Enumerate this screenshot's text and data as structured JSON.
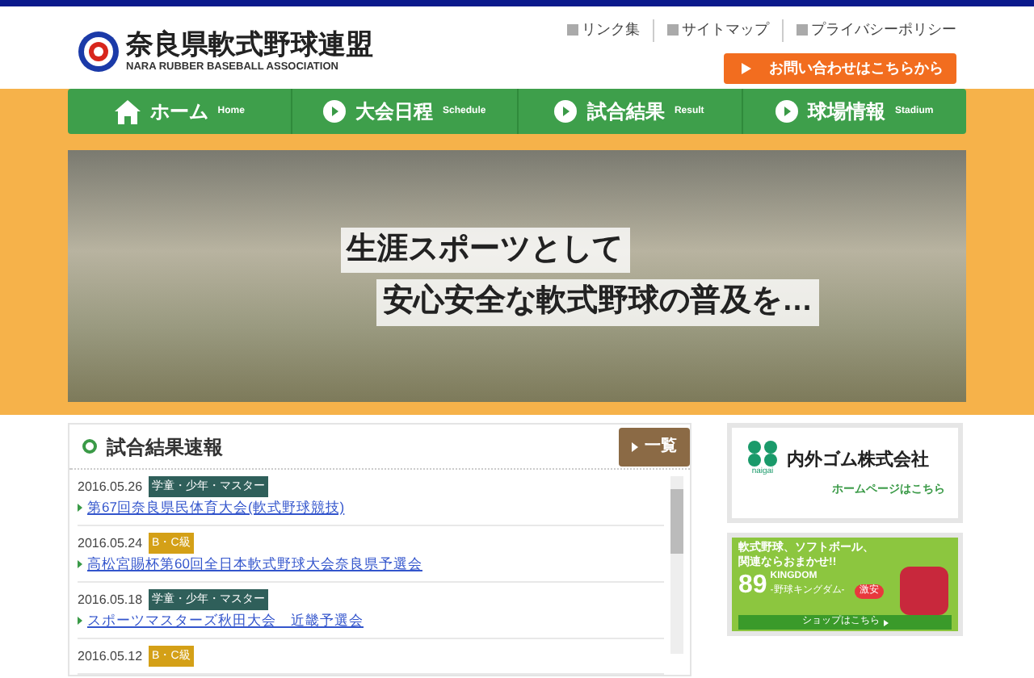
{
  "header": {
    "title": "奈良県軟式野球連盟",
    "subtitle": "NARA RUBBER BASEBALL ASSOCIATION",
    "links": [
      "リンク集",
      "サイトマップ",
      "プライバシーポリシー"
    ],
    "contact_button": "お問い合わせはこちらから"
  },
  "nav": [
    {
      "label": "ホーム",
      "sub": "Home",
      "kind": "home"
    },
    {
      "label": "大会日程",
      "sub": "Schedule",
      "kind": "arrow"
    },
    {
      "label": "試合結果",
      "sub": "Result",
      "kind": "arrow"
    },
    {
      "label": "球場情報",
      "sub": "Stadium",
      "kind": "arrow"
    }
  ],
  "hero": {
    "lines": [
      "生涯スポーツとして",
      "安心安全な軟式野球の普及を…"
    ]
  },
  "results": {
    "title": "試合結果速報",
    "more": "一覧",
    "items": [
      {
        "date": "2016.05.26",
        "tag": "学童・少年・マスター",
        "color": "#2f5f5a",
        "link": "第67回奈良県民体育大会(軟式野球競技)"
      },
      {
        "date": "2016.05.24",
        "tag": "B・C級",
        "color": "#d4a017",
        "link": "高松宮賜杯第60回全日本軟式野球大会奈良県予選会"
      },
      {
        "date": "2016.05.18",
        "tag": "学童・少年・マスター",
        "color": "#2f5f5a",
        "link": "スポーツマスターズ秋田大会　近畿予選会"
      },
      {
        "date": "2016.05.12",
        "tag": "B・C級",
        "color": "#d4a017"
      }
    ]
  },
  "banners": [
    {
      "name": "内外ゴム株式会社",
      "brand": "naigai",
      "cta": "ホームページはこちら"
    },
    {
      "headline": "軟式野球、ソフトボール、関連ならおまかせ!!",
      "brand": "89",
      "brand_sub": "KINGDOM",
      "brand_caption": "-野球キングダム-",
      "badge": "激安",
      "cta": "ショップはこちら"
    }
  ]
}
